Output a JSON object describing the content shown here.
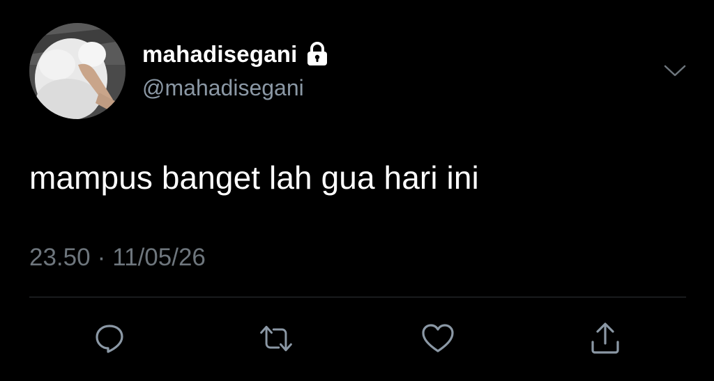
{
  "user": {
    "display_name": "mahadisegani",
    "handle": "@mahadisegani",
    "protected_icon": "lock-icon",
    "avatar": "white-dog-photo"
  },
  "tweet": {
    "text": "mampus banget lah gua hari ini",
    "time": "23.50",
    "separator": "·",
    "date": "11/05/26"
  },
  "actions": {
    "reply_icon": "reply-icon",
    "retweet_icon": "retweet-icon",
    "like_icon": "heart-icon",
    "share_icon": "share-icon"
  },
  "colors": {
    "background": "#000000",
    "primary_text": "#ffffff",
    "secondary_text": "#8b98a5",
    "timestamp_text": "#6e767d",
    "divider": "#2f3336",
    "icon": "#8b98a5"
  }
}
